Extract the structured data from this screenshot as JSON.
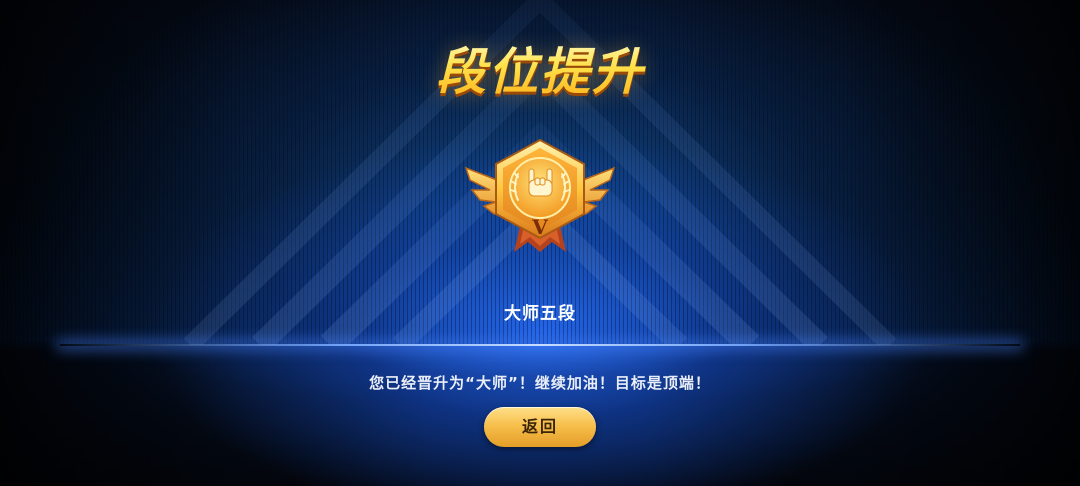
{
  "screen": {
    "title": "段位提升",
    "rank_name": "大师五段",
    "rank_tier_numeral": "V",
    "message": "您已经晋升为“大师”！继续加油！目标是顶端！",
    "back_button_label": "返回"
  },
  "badge": {
    "icon": "rock-hand-icon",
    "emblem": "laurel-wreath-icon"
  },
  "colors": {
    "title_gold": "#ffd43a",
    "button_gold": "#f7c04c",
    "accent_blue": "#2f6cff"
  }
}
